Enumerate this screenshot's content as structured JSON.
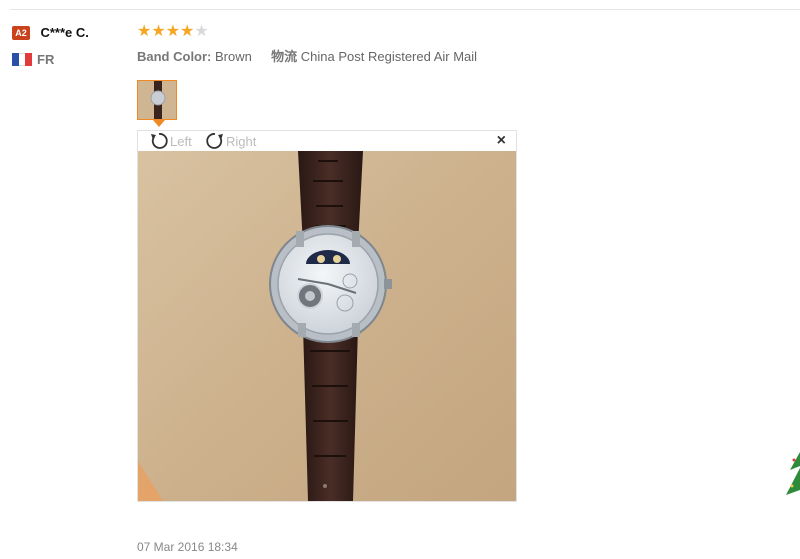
{
  "review": {
    "badge": "A2",
    "user_name": "C***e C.",
    "country": "FR",
    "rating": 4,
    "rating_max": 5,
    "band_color_key": "Band Color:",
    "band_color_value": "Brown",
    "shipping_key": "物流",
    "shipping_value": "China Post Registered Air Mail",
    "date": "07 Mar 2016 18:34"
  },
  "viewer": {
    "rotate_left_label": "Left",
    "rotate_right_label": "Right",
    "close_label": "×"
  },
  "colors": {
    "accent": "#f08a24",
    "badge": "#c9421b",
    "star": "#f5a623"
  }
}
